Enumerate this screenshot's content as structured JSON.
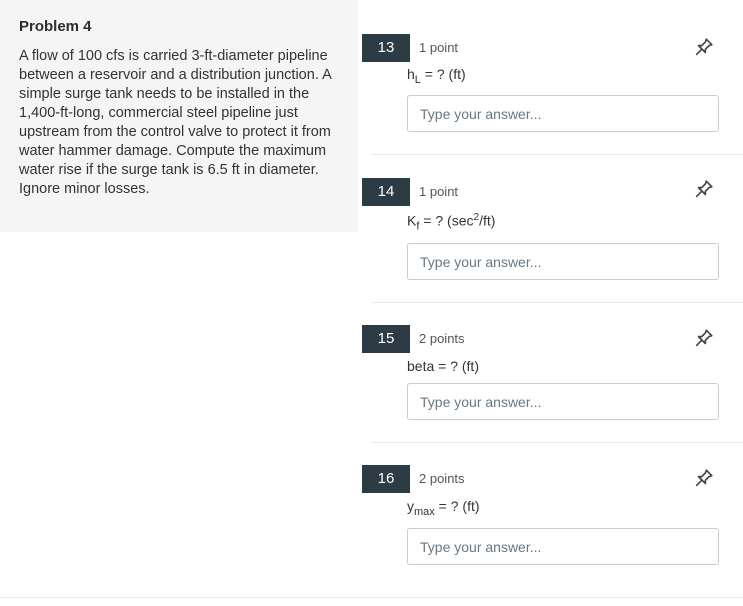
{
  "problem": {
    "title": "Problem 4",
    "text": "A flow of 100 cfs is carried 3-ft-diameter pipeline between a reservoir and a distribution junction. A simple surge tank needs to be installed in the 1,400-ft-long, commercial steel pipeline just upstream from the control valve to protect it from water hammer damage. Compute the maximum water rise if the surge tank is 6.5 ft in diameter. Ignore minor losses."
  },
  "input_placeholder": "Type your answer...",
  "icons": {
    "pin": "pin-icon"
  },
  "colors": {
    "number_badge": "#2d3b45",
    "panel_bg": "#f5f5f5"
  },
  "questions": [
    {
      "number": "13",
      "points": "1 point",
      "label_main": "h",
      "label_sub": "L",
      "label_rest": " = ? (ft)"
    },
    {
      "number": "14",
      "points": "1 point",
      "label_main": "K",
      "label_sub": "f",
      "label_mid": " = ? (sec",
      "label_sup": "2",
      "label_rest": "/ft)"
    },
    {
      "number": "15",
      "points": "2 points",
      "label_main": "beta = ? (ft)"
    },
    {
      "number": "16",
      "points": "2 points",
      "label_main": "y",
      "label_sub": "max",
      "label_rest": " = ? (ft)"
    }
  ]
}
